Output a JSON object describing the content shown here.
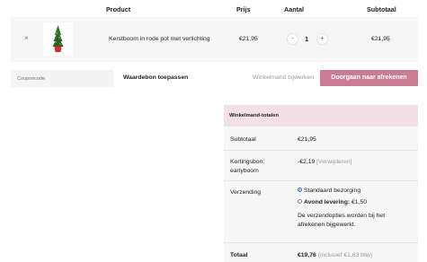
{
  "cart": {
    "headers": {
      "product": "Product",
      "price": "Prijs",
      "quantity": "Aantal",
      "subtotal": "Subtotaal"
    },
    "item": {
      "remove": "×",
      "name": "Kerstboom in rode pot met verlichting",
      "price": "€21,95",
      "quantity": "1",
      "minus": "-",
      "plus": "+",
      "subtotal": "€21,95"
    }
  },
  "actions": {
    "coupon_placeholder": "Couponcode",
    "apply_coupon": "Waardebon toepassen",
    "update_cart": "Winkelmand bijwerken",
    "checkout": "Doorgaan naar afrekenen"
  },
  "totals": {
    "title": "Winkelmand-totalen",
    "subtotal_label": "Subtotaal",
    "subtotal_value": "€21,95",
    "coupon_label_1": "Kortingsbon:",
    "coupon_label_2": "earlyboom",
    "coupon_value": "-€2,19",
    "coupon_remove": "[Verwijderen]",
    "shipping_label": "Verzending",
    "shipping_option_1": "Standaard bezorging",
    "shipping_option_2_name": "Avond levering:",
    "shipping_option_2_price": "€1,50",
    "shipping_note_1": "De verzendopties worden bij het",
    "shipping_note_2": "afrekenen bijgewerkt.",
    "total_label": "Totaal",
    "total_value": "€19,76",
    "total_vat": "(inclusief €1,63 btw)"
  },
  "colors": {
    "accent": "#c97c93",
    "totals_header": "#f3e0e6",
    "radio": "#1e6fe0"
  }
}
